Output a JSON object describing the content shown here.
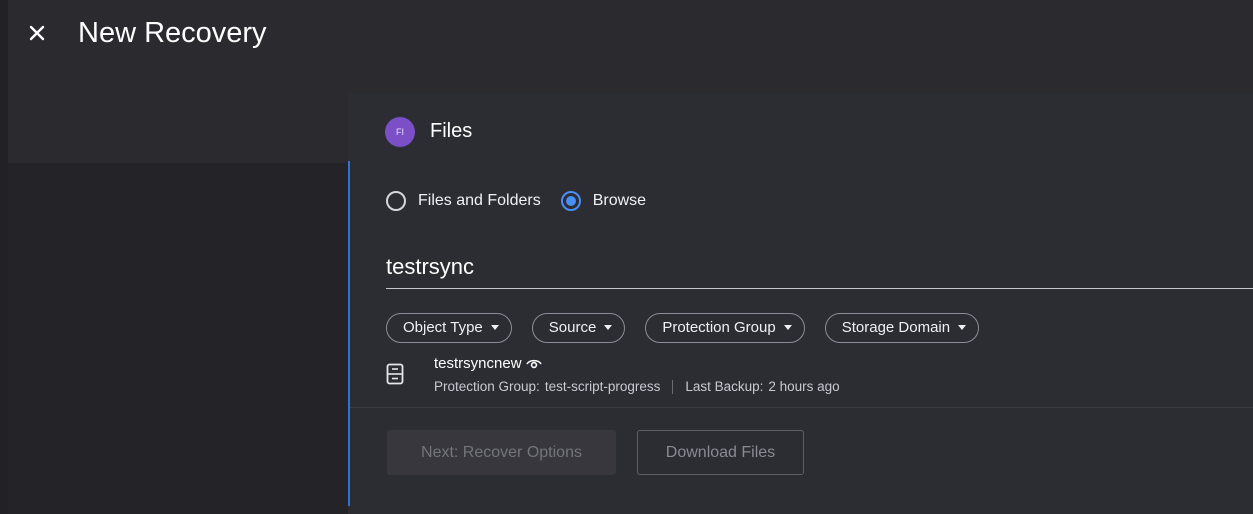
{
  "header": {
    "title": "New Recovery"
  },
  "card": {
    "badge_text": "FI",
    "title": "Files"
  },
  "recovery_mode": {
    "options": [
      {
        "label": "Files and Folders",
        "checked": false
      },
      {
        "label": "Browse",
        "checked": true
      }
    ]
  },
  "search": {
    "value": "testrsync"
  },
  "filters": [
    {
      "label": "Object Type"
    },
    {
      "label": "Source"
    },
    {
      "label": "Protection Group"
    },
    {
      "label": "Storage Domain"
    }
  ],
  "result": {
    "name": "testrsyncnew",
    "protection_group_label": "Protection Group:",
    "protection_group_value": "test-script-progress",
    "last_backup_label": "Last Backup:",
    "last_backup_value": "2 hours ago"
  },
  "actions": {
    "next_label": "Next: Recover Options",
    "download_label": "Download Files"
  },
  "icons": {
    "close": "close-icon",
    "server": "server-icon",
    "eye": "eye-icon",
    "chevron": "chevron-down-icon"
  },
  "colors": {
    "accent": "#4a8ef7",
    "badge": "#7b4fc6",
    "rail": "#2f74d0"
  }
}
